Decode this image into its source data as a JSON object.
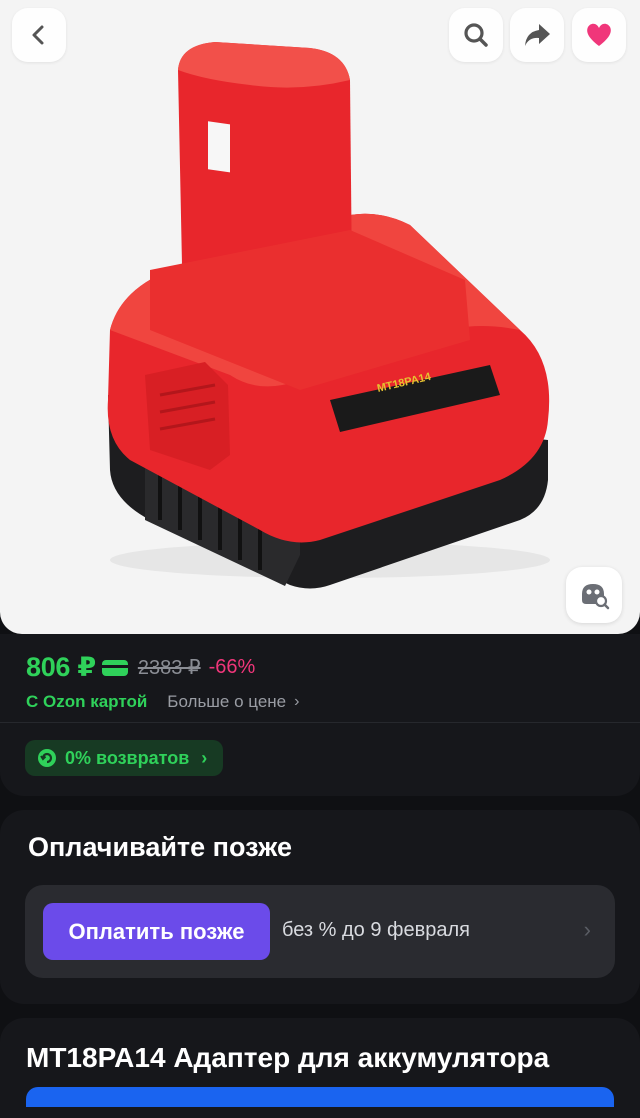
{
  "nav": {
    "back_icon": "chevron-left-icon",
    "search_icon": "search-icon",
    "share_icon": "share-arrow-icon",
    "favorite_icon": "heart-icon",
    "favorite_color": "#f0367a"
  },
  "product_image": {
    "label_text": "MT18PA14",
    "visual_search_icon": "image-search-icon"
  },
  "price": {
    "current": "806 ₽",
    "old": "2383 ₽",
    "discount": "-66%",
    "ozon_card_label": "С Ozon картой",
    "more_label": "Больше о цене",
    "accent_color": "#2fd15a",
    "discount_color": "#f0367a"
  },
  "returns": {
    "label": "0% возвратов"
  },
  "pay_later": {
    "title": "Оплачивайте позже",
    "button_label": "Оплатить позже",
    "description": "без % до 9 февраля",
    "button_color": "#6b4bea"
  },
  "product": {
    "title": "MT18PA14 Адаптер для аккумулятора"
  }
}
